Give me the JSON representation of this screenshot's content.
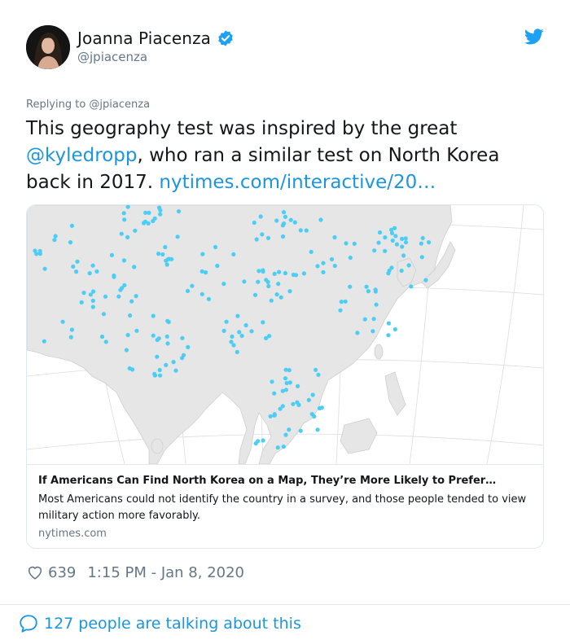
{
  "author": {
    "display_name": "Joanna Piacenza",
    "handle": "@jpiacenza",
    "verified": true
  },
  "reply_context": "Replying to @jpiacenza",
  "text": {
    "part1": "This geography test was inspired by the great ",
    "mention": "@kyledropp",
    "part2": ", who ran a similar test on North Korea back in 2017. ",
    "url": "nytimes.com/interactive/20…"
  },
  "card": {
    "title": "If Americans Can Find North Korea on a Map, They’re More Likely to Prefer…",
    "description": "Most Americans could not identify the country in a survey, and those people tended to view military action more favorably.",
    "domain": "nytimes.com"
  },
  "meta": {
    "likes": "639",
    "timestamp": "1:15 PM - Jan 8, 2020"
  },
  "footer": {
    "talking": "127 people are talking about this"
  },
  "colors": {
    "link": "#1b95e0",
    "muted": "#657786",
    "border": "#e1e8ed",
    "map_land": "#e6e6e6",
    "map_dot": "#4ccdf5"
  }
}
